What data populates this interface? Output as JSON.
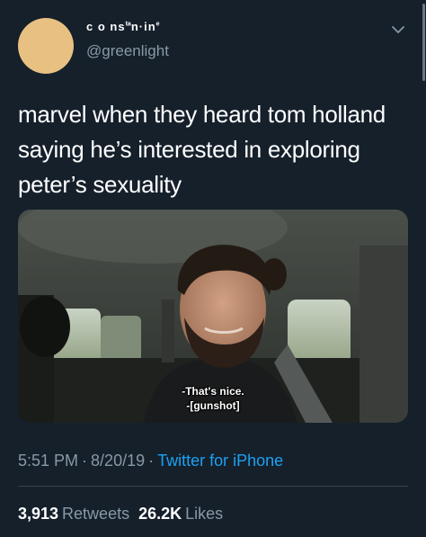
{
  "author": {
    "display_name_main": "c o ns",
    "display_name_sup": "ta",
    "display_name_tail": "n·in",
    "display_name_sup2": "e",
    "handle": "@greenlight",
    "avatar_color": "#e8c082"
  },
  "tweet": {
    "text": "marvel when they heard tom holland saying he’s interested in exploring peter’s sexuality"
  },
  "media": {
    "subtitle_line1": "-That's nice.",
    "subtitle_line2": "-[gunshot]"
  },
  "meta": {
    "time": "5:51 PM",
    "separator": "·",
    "date": "8/20/19",
    "source": "Twitter for iPhone"
  },
  "stats": {
    "retweets_count": "3,913",
    "retweets_label": "Retweets",
    "likes_count": "26.2K",
    "likes_label": "Likes"
  },
  "icons": {
    "menu": "chevron-down-icon"
  },
  "colors": {
    "background": "#15202b",
    "secondary_text": "#8899a6",
    "link": "#1da1f2",
    "divider": "#38444d"
  }
}
